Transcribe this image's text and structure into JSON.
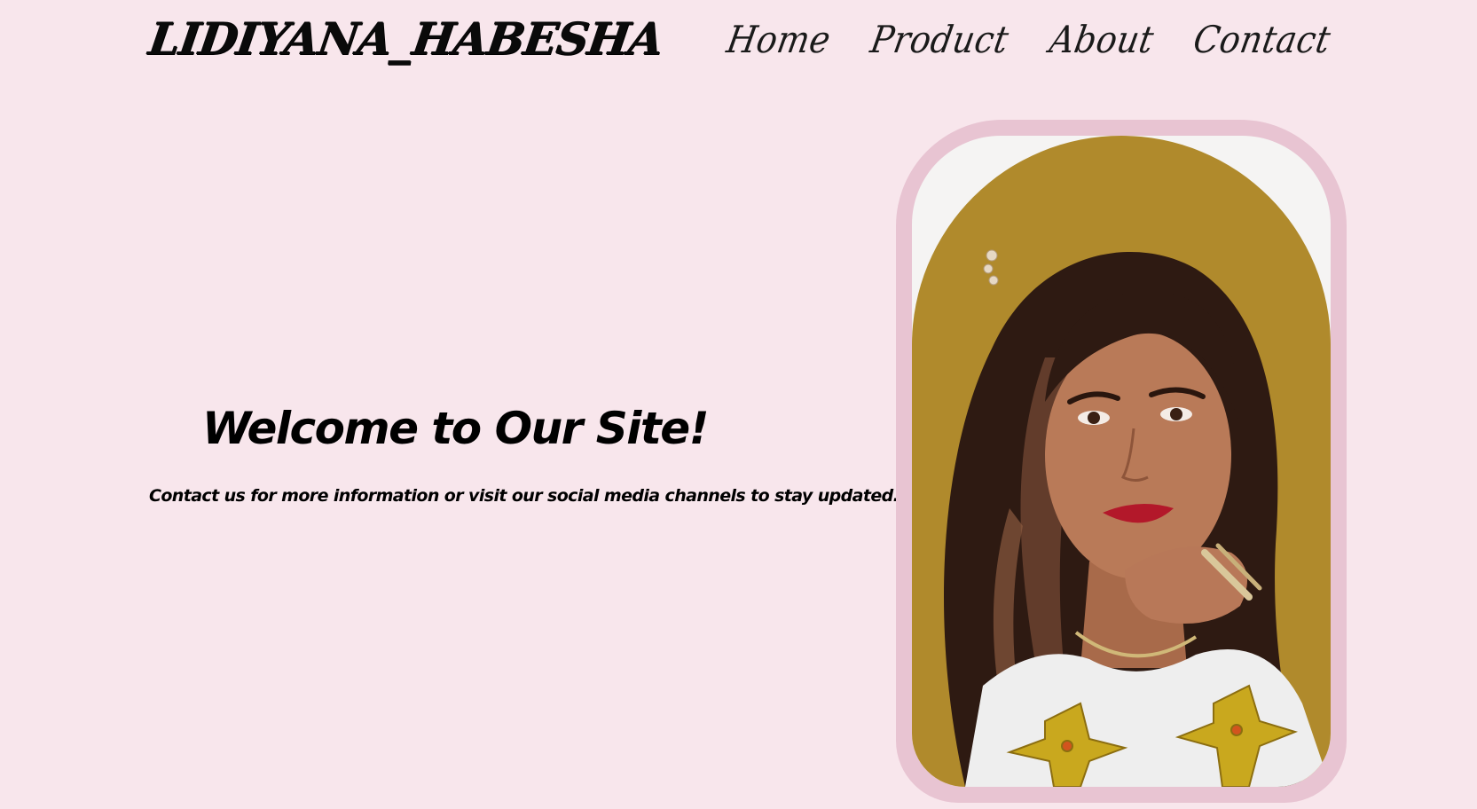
{
  "header": {
    "brand": "LIDIYANA_HABESHA",
    "nav": [
      {
        "label": "Home"
      },
      {
        "label": "Product"
      },
      {
        "label": "About"
      },
      {
        "label": "Contact"
      }
    ]
  },
  "hero": {
    "title": "Welcome to Our Site!",
    "subtitle": "Contact us for more information or visit our social media channels to stay updated."
  },
  "colors": {
    "page_background": "#f8e6ec",
    "frame": "#e8c4d2",
    "portrait_backdrop": "#b08a2c"
  },
  "portrait": {
    "icon": "portrait-photo"
  }
}
